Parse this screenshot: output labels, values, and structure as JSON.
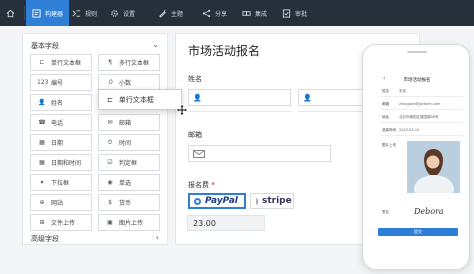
{
  "toolbar": {
    "items": [
      {
        "label": "构建器",
        "icon": "build-icon"
      },
      {
        "label": "规则",
        "icon": "rules-icon"
      },
      {
        "label": "设置",
        "icon": "gear-icon"
      },
      {
        "label": "主题",
        "icon": "theme-icon"
      },
      {
        "label": "分享",
        "icon": "share-icon"
      },
      {
        "label": "集成",
        "icon": "integration-icon"
      },
      {
        "label": "审批",
        "icon": "approval-icon"
      }
    ],
    "active": "构建器",
    "accent": "#2f7fd6",
    "bg": "#26303b"
  },
  "palette": {
    "basic_header": "基本字段",
    "advanced_header": "高级字段",
    "fields": [
      {
        "icon": "⊏",
        "label": "单行文本框"
      },
      {
        "icon": "¶",
        "label": "多行文本框"
      },
      {
        "icon": "123",
        "label": "编号"
      },
      {
        "icon": ".0",
        "label": "小数"
      },
      {
        "icon": "👤",
        "label": "姓名"
      },
      {
        "icon": "✉",
        "label": "邮箱"
      },
      {
        "icon": "☎",
        "label": "电话"
      },
      {
        "icon": "⏱",
        "label": "时间"
      },
      {
        "icon": "▦",
        "label": "日期"
      },
      {
        "icon": "☑",
        "label": "判定框"
      },
      {
        "icon": "▦",
        "label": "日期和时间"
      },
      {
        "icon": "◉",
        "label": "单选"
      },
      {
        "icon": "▾",
        "label": "下拉框"
      },
      {
        "icon": "$",
        "label": "货币"
      },
      {
        "icon": "⊕",
        "label": "网站"
      },
      {
        "icon": "▣",
        "label": "图片上传"
      },
      {
        "icon": "⊞",
        "label": "文件上传"
      }
    ]
  },
  "ghost": {
    "icon": "⊏",
    "label": "单行文本框"
  },
  "form": {
    "title": "市场活动报名",
    "name_label": "姓名",
    "email_label": "邮箱",
    "fee_label": "报名费",
    "required_mark": "*",
    "payment_paypal": "PayPal",
    "payment_stripe": "stripe",
    "amount": "23.00"
  },
  "phone": {
    "title": "市场活动报名",
    "rows": [
      {
        "k": "姓名",
        "v": "张伟"
      },
      {
        "k": "邮箱",
        "v": "zhangwei@jotform.com"
      },
      {
        "k": "地址",
        "v": "北京市朝阳区建国路88号"
      },
      {
        "k": "选择时间",
        "v": "2023-05-10"
      }
    ],
    "photo_label": "图片上传",
    "signature_label": "签名",
    "signature_text": "Debora",
    "submit": "提交"
  }
}
